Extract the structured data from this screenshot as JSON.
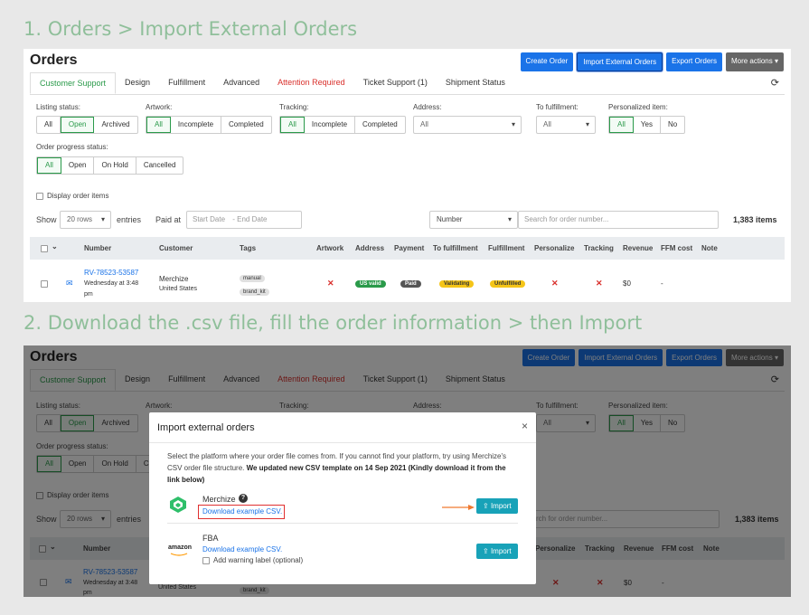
{
  "steps": {
    "step1": "1. Orders > Import External Orders",
    "step2": "2. Download the .csv file, fill the order information > then Import"
  },
  "page": {
    "title": "Orders",
    "buttons": {
      "create": "Create Order",
      "import": "Import External Orders",
      "export": "Export Orders",
      "more": "More actions ▾"
    },
    "tabs": [
      "Customer Support",
      "Design",
      "Fulfillment",
      "Advanced",
      "Attention Required",
      "Ticket Support (1)",
      "Shipment Status"
    ]
  },
  "filters": {
    "listing_status": {
      "label": "Listing status:",
      "options": [
        "All",
        "Open",
        "Archived"
      ]
    },
    "artwork": {
      "label": "Artwork:",
      "options": [
        "All",
        "Incomplete",
        "Completed"
      ]
    },
    "tracking": {
      "label": "Tracking:",
      "options": [
        "All",
        "Incomplete",
        "Completed"
      ]
    },
    "address": {
      "label": "Address:",
      "value": "All"
    },
    "to_fulfillment": {
      "label": "To fulfillment:",
      "value": "All"
    },
    "personalized": {
      "label": "Personalized item:",
      "options": [
        "All",
        "Yes",
        "No"
      ]
    },
    "progress": {
      "label": "Order progress status:",
      "options": [
        "All",
        "Open",
        "On Hold",
        "Cancelled"
      ]
    },
    "display_items": "Display order items"
  },
  "toolbar": {
    "show": "Show",
    "rows": "20 rows",
    "entries": "entries",
    "paid_at": "Paid at",
    "start_date": "Start Date",
    "end_date": "- End Date",
    "search_by": "Number",
    "search_placeholder": "Search for order number...",
    "search_placeholder_partial": "rch for order number...",
    "items": "1,383 items"
  },
  "table": {
    "headers": [
      "Number",
      "Customer",
      "Tags",
      "Artwork",
      "Address",
      "Payment",
      "To fulfillment",
      "Fulfillment",
      "Personalize",
      "Tracking",
      "Revenue",
      "FFM cost",
      "Note"
    ],
    "row": {
      "number": "RV-78523-53587",
      "date1": "Wednesday at 3:48",
      "date2": "pm",
      "customer": "Merchize",
      "country": "United States",
      "tags": [
        "manual",
        "brand_kit"
      ],
      "address": "US valid",
      "payment": "Paid",
      "to_fulfillment": "Validating",
      "fulfillment": "Unfulfilled",
      "revenue": "$0",
      "ffm_cost": "-"
    }
  },
  "modal": {
    "title": "Import external orders",
    "close": "×",
    "desc_plain": "Select the platform where your order file comes from. If you cannot find your platform, try using Merchize's CSV order file structure. ",
    "desc_bold": "We updated new CSV template on 14 Sep 2021 (Kindly download it from the link below)",
    "merchize": {
      "name": "Merchize",
      "help": "?",
      "link": "Download example CSV.",
      "import": "Import"
    },
    "fba": {
      "logo": "amazon",
      "name": "FBA",
      "link": "Download example CSV.",
      "warning": "Add warning label (optional)",
      "import": "Import"
    }
  },
  "colors": {
    "accent": "#1a73e8",
    "green": "#2a9a4a",
    "teal": "#18a2b8",
    "highlight": "#e03030",
    "arrow": "#f07a30"
  }
}
